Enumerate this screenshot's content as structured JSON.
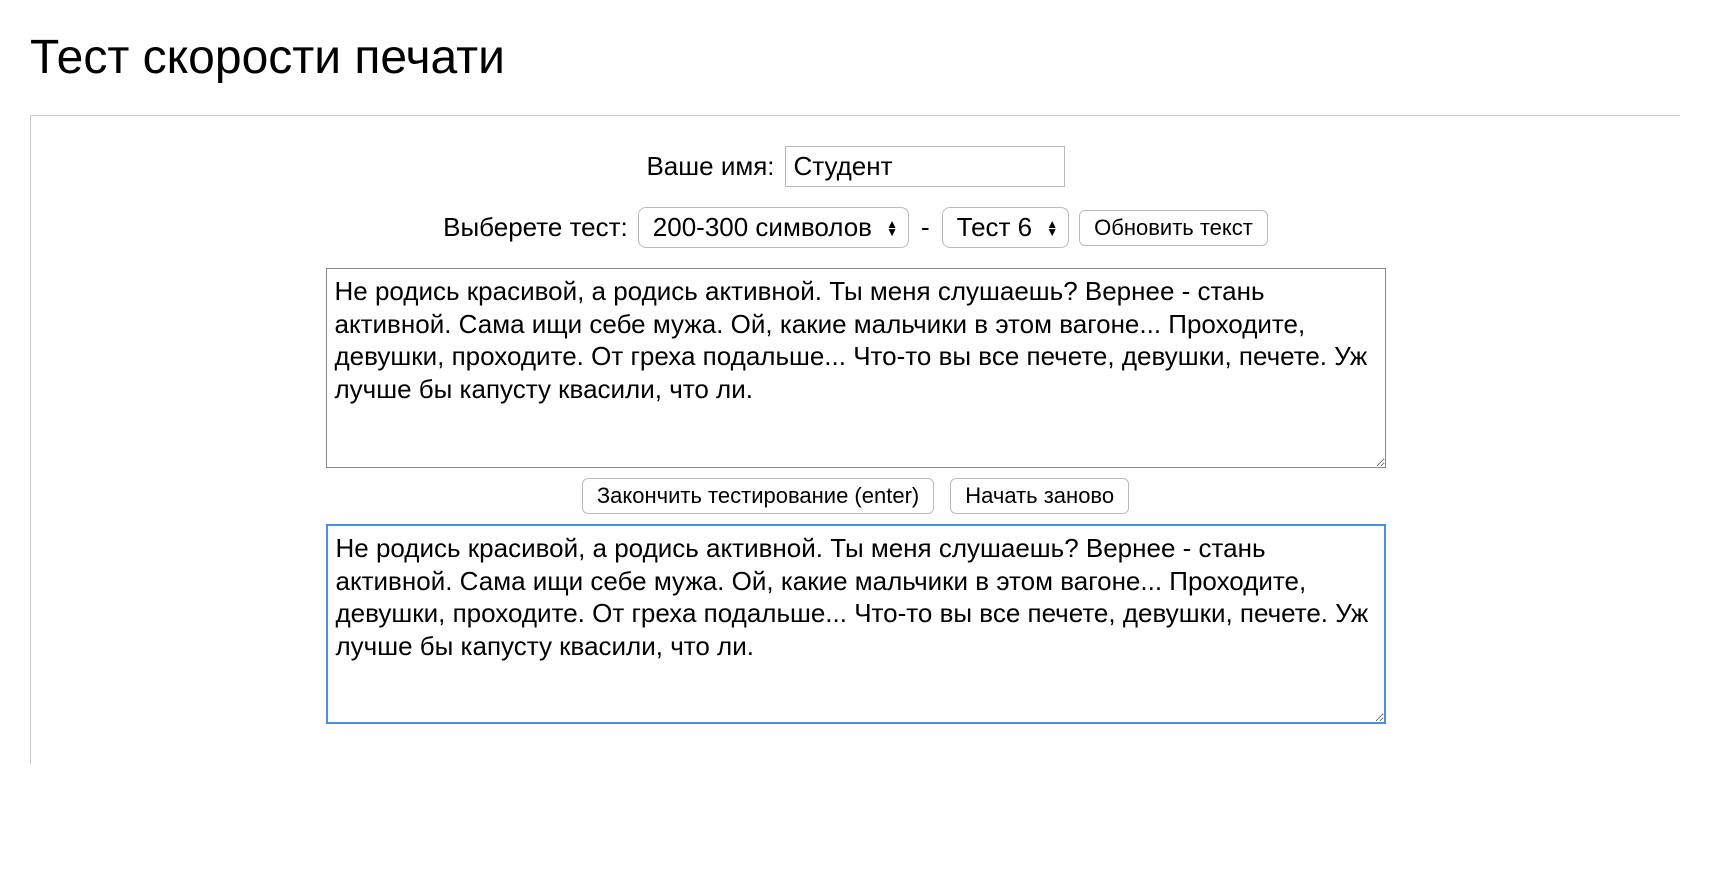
{
  "title": "Тест скорости печати",
  "nameRow": {
    "label": "Ваше имя:",
    "value": "Студент"
  },
  "testRow": {
    "label": "Выберете тест:",
    "lengthSelect": "200-300 символов",
    "dash": "-",
    "testSelect": "Тест 6",
    "refreshButton": "Обновить текст"
  },
  "referenceText": "Не родись красивой, а родись активной. Ты меня слушаешь? Вернее - стань активной. Сама ищи себе мужа. Ой, какие мальчики в этом вагоне... Проходите, девушки, проходите. От греха подальше... Что-то вы все печете, девушки, печете. Уж лучше бы капусту квасили, что ли.",
  "buttons": {
    "finish": "Закончить тестирование (enter)",
    "restart": "Начать заново"
  },
  "typedText": "Не родись красивой, а родись активной. Ты меня слушаешь? Вернее - стань активной. Сама ищи себе мужа. Ой, какие мальчики в этом вагоне... Проходите, девушки, проходите. От греха подальше... Что-то вы все печете, девушки, печете. Уж лучше бы капусту квасили, что ли."
}
